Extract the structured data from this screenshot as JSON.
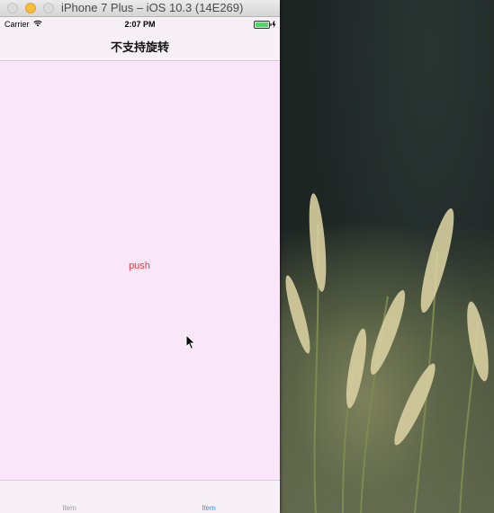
{
  "window": {
    "title": "iPhone 7 Plus – iOS 10.3 (14E269)"
  },
  "status_bar": {
    "carrier": "Carrier",
    "time": "2:07 PM"
  },
  "nav_bar": {
    "title": "不支持旋转"
  },
  "content": {
    "push_label": "push",
    "background_color": "#f9e6f9",
    "push_color": "#e03b3b"
  },
  "tab_bar": {
    "items": [
      {
        "label": "Item",
        "selected": false
      },
      {
        "label": "Item",
        "selected": true
      }
    ],
    "selected_color": "#3b8ee6"
  },
  "icons": {
    "close": "close-button",
    "minimize": "minimize-button",
    "zoom": "zoom-button",
    "wifi": "wifi-icon",
    "battery": "battery-icon",
    "cursor": "cursor-icon"
  }
}
